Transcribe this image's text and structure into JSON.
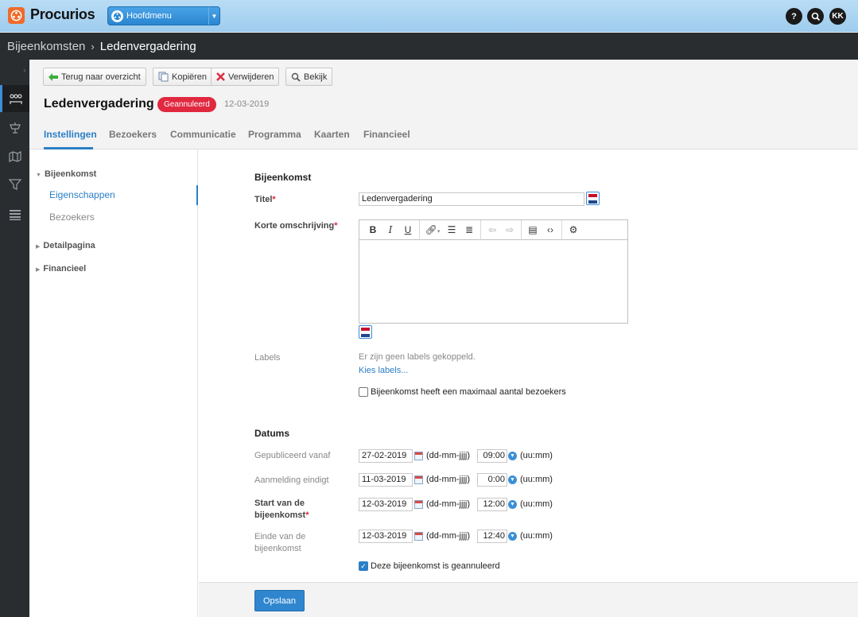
{
  "app": {
    "logo_text": "Procurios",
    "main_menu_label": "Hoofdmenu",
    "help_label": "?",
    "user_initials": "KK"
  },
  "breadcrumb": {
    "parent": "Bijeenkomsten",
    "separator": "›",
    "current": "Ledenvergadering"
  },
  "toolbar": {
    "back_label": "Terug naar overzicht",
    "copy_label": "Kopiëren",
    "delete_label": "Verwijderen",
    "view_label": "Bekijk"
  },
  "page": {
    "title": "Ledenvergadering",
    "status_badge": "Geannuleerd",
    "date": "12-03-2019",
    "tabs": [
      {
        "label": "Instellingen",
        "active": true
      },
      {
        "label": "Bezoekers"
      },
      {
        "label": "Communicatie"
      },
      {
        "label": "Programma"
      },
      {
        "label": "Kaarten"
      },
      {
        "label": "Financieel"
      }
    ]
  },
  "section_nav": {
    "groups": [
      {
        "label": "Bijeenkomst",
        "expanded": true,
        "items": [
          "Eigenschappen",
          "Bezoekers"
        ]
      },
      {
        "label": "Detailpagina"
      },
      {
        "label": "Financieel"
      }
    ]
  },
  "form": {
    "section1_title": "Bijeenkomst",
    "title_label": "Titel",
    "required_mark": "*",
    "title_value": "Ledenvergadering",
    "short_desc_label": "Korte omschrijving",
    "labels_label": "Labels",
    "labels_empty": "Er zijn geen labels gekoppeld.",
    "labels_choose": "Kies labels...",
    "max_visitors_label": "Bijeenkomst heeft een maximaal aantal bezoekers",
    "section2_title": "Datums",
    "date_format": "(dd-mm-jjjj)",
    "time_format": "(uu:mm)",
    "dates": [
      {
        "label": "Gepubliceerd vanaf",
        "date": "27-02-2019",
        "time": "09:00"
      },
      {
        "label": "Aanmelding eindigt",
        "date": "11-03-2019",
        "time": "0:00"
      },
      {
        "label": "Start van de bijeenkomst",
        "date": "12-03-2019",
        "time": "12:00"
      },
      {
        "label": "Einde van de bijeenkomst",
        "date": "12-03-2019",
        "time": "12:40"
      }
    ],
    "cancelled_label": "Deze bijeenkomst is geannuleerd",
    "save_label": "Opslaan"
  },
  "colors": {
    "accent": "#2a7fc6",
    "badge": "#e0283f",
    "logo": "#f06a2a"
  }
}
